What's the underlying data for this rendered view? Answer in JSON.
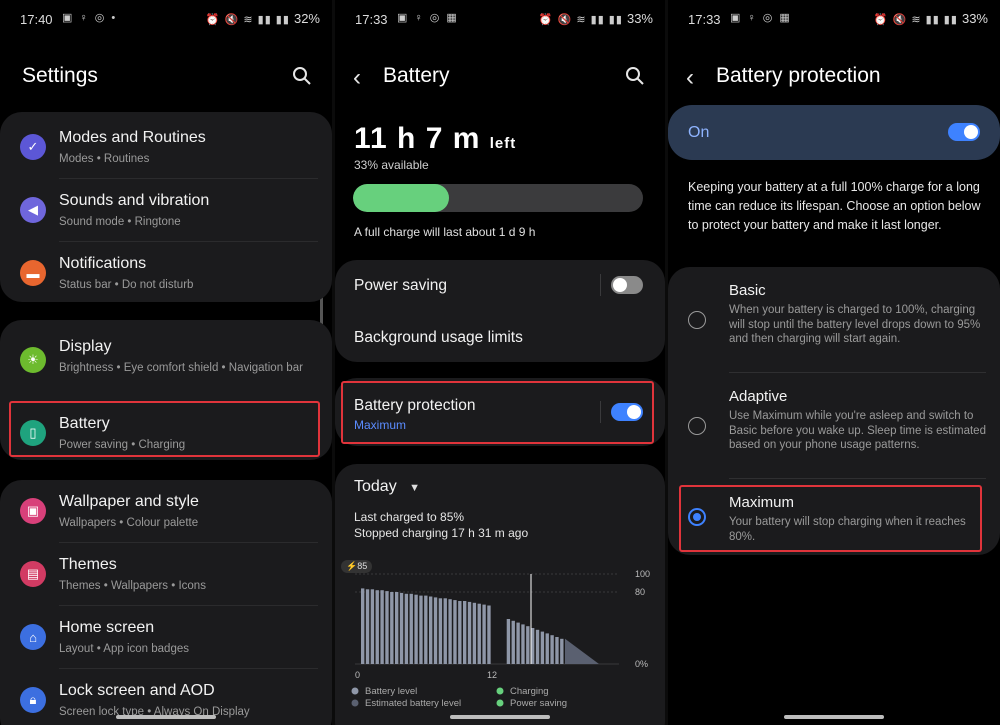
{
  "colors": {
    "accent_blue": "#3e82ff",
    "battery_green": "#67d07d",
    "highlight_red": "#e0343b",
    "card_bg": "#1b1b1d"
  },
  "screen1": {
    "status": {
      "time": "17:40",
      "battery": "32%"
    },
    "title": "Settings",
    "groups": [
      {
        "items": [
          {
            "title": "Modes and Routines",
            "subtitle": "Modes  •  Routines",
            "icon": "modes-icon",
            "color": "#5c57d6"
          },
          {
            "title": "Sounds and vibration",
            "subtitle": "Sound mode  •  Ringtone",
            "icon": "sound-icon",
            "color": "#6f66dc"
          },
          {
            "title": "Notifications",
            "subtitle": "Status bar  •  Do not disturb",
            "icon": "notification-icon",
            "color": "#e8662f"
          }
        ]
      },
      {
        "items": [
          {
            "title": "Display",
            "subtitle": "Brightness  •  Eye comfort shield  •  Navigation bar",
            "icon": "display-icon",
            "color": "#6dbb2e"
          },
          {
            "title": "Battery",
            "subtitle": "Power saving  •  Charging",
            "icon": "battery-icon",
            "color": "#1fa37e"
          }
        ]
      },
      {
        "items": [
          {
            "title": "Wallpaper and style",
            "subtitle": "Wallpapers  •  Colour palette",
            "icon": "wallpaper-icon",
            "color": "#d8407a"
          },
          {
            "title": "Themes",
            "subtitle": "Themes  •  Wallpapers  •  Icons",
            "icon": "themes-icon",
            "color": "#d23b63"
          },
          {
            "title": "Home screen",
            "subtitle": "Layout  •  App icon badges",
            "icon": "home-icon",
            "color": "#3c6fe0"
          },
          {
            "title": "Lock screen and AOD",
            "subtitle": "Screen lock type  •  Always On Display",
            "icon": "lock-icon",
            "color": "#3c6fe0"
          }
        ]
      }
    ]
  },
  "screen2": {
    "status": {
      "time": "17:33",
      "battery": "33%"
    },
    "title": "Battery",
    "time_left": "11 h 7 m",
    "time_left_suffix": "left",
    "available": "33% available",
    "level": 0.33,
    "full_charge": "A full charge will last about 1 d 9 h",
    "power_saving": {
      "label": "Power saving",
      "on": false
    },
    "background_limits": "Background usage limits",
    "protection": {
      "label": "Battery protection",
      "value": "Maximum",
      "on": true
    },
    "usage": {
      "period": "Today",
      "last_charged": "Last charged to 85%",
      "stopped": "Stopped charging 17 h 31 m ago"
    },
    "chart_data": {
      "type": "bar",
      "badge": "85",
      "x_ticks": [
        "0",
        "12"
      ],
      "y_ticks": [
        "100",
        "80",
        "0%"
      ],
      "ylim": [
        0,
        100
      ],
      "values": [
        84,
        83,
        83,
        82,
        82,
        81,
        80,
        80,
        79,
        78,
        78,
        77,
        76,
        76,
        75,
        74,
        73,
        73,
        72,
        71,
        70,
        70,
        69,
        68,
        67,
        66,
        65,
        0,
        0,
        0,
        50,
        48,
        46,
        44,
        42,
        40,
        38,
        36,
        34,
        32,
        30,
        28
      ],
      "estimated_tail": [
        28,
        0
      ],
      "legend": [
        "Battery level",
        "Charging",
        "Estimated battery level",
        "Power saving"
      ]
    }
  },
  "screen3": {
    "status": {
      "time": "17:33",
      "battery": "33%"
    },
    "title": "Battery protection",
    "on_label": "On",
    "description": "Keeping your battery at a full 100% charge for a long time can reduce its lifespan. Choose an option below to protect your battery and make it last longer.",
    "options": [
      {
        "title": "Basic",
        "desc": "When your battery is charged to 100%, charging will stop until the battery level drops down to 95% and then charging will start again.",
        "selected": false
      },
      {
        "title": "Adaptive",
        "desc": "Use Maximum while you're asleep and switch to Basic before you wake up. Sleep time is estimated based on your phone usage patterns.",
        "selected": false
      },
      {
        "title": "Maximum",
        "desc": "Your battery will stop charging when it reaches 80%.",
        "selected": true
      }
    ]
  }
}
